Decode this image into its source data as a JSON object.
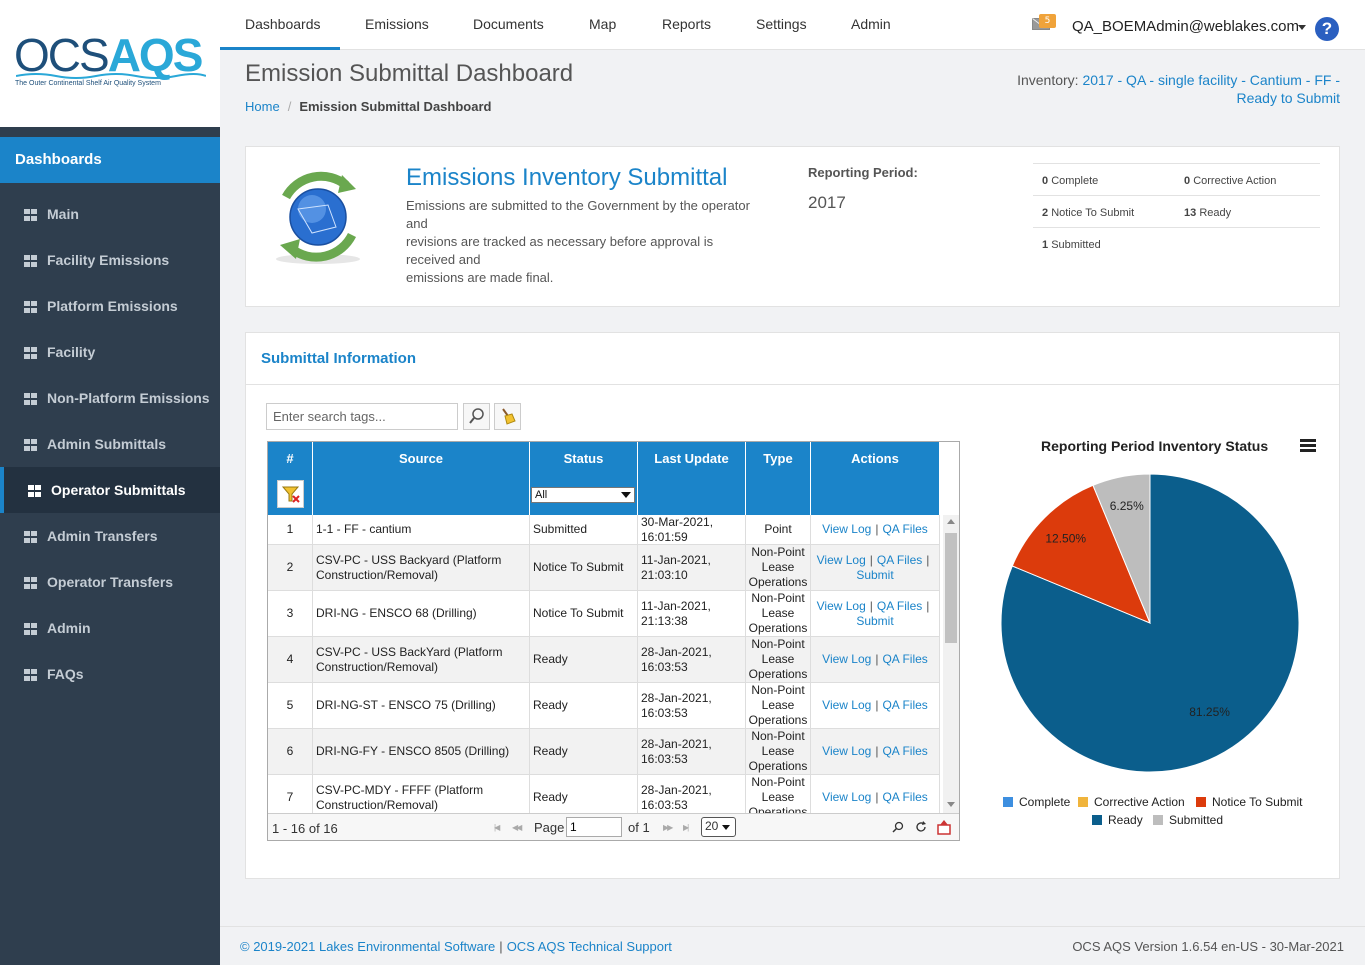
{
  "app": {
    "logo_ocs": "OCS",
    "logo_aqs": "AQS",
    "logo_tagline": "The Outer Continental Shelf Air Quality System"
  },
  "sidebar": {
    "section_title": "Dashboards",
    "items": [
      {
        "label": "Main",
        "active": false
      },
      {
        "label": "Facility Emissions",
        "active": false
      },
      {
        "label": "Platform Emissions",
        "active": false
      },
      {
        "label": "Facility",
        "active": false
      },
      {
        "label": "Non-Platform Emissions",
        "active": false
      },
      {
        "label": "Admin Submittals",
        "active": false
      },
      {
        "label": "Operator Submittals",
        "active": true
      },
      {
        "label": "Admin Transfers",
        "active": false
      },
      {
        "label": "Operator Transfers",
        "active": false
      },
      {
        "label": "Admin",
        "active": false
      },
      {
        "label": "FAQs",
        "active": false
      }
    ]
  },
  "topnav": {
    "items": [
      "Dashboards",
      "Emissions",
      "Documents",
      "Map",
      "Reports",
      "Settings",
      "Admin"
    ],
    "active": "Dashboards",
    "mail_count": "5",
    "user": "QA_BOEMAdmin@weblakes.com",
    "help": "?"
  },
  "page": {
    "title": "Emission Submittal Dashboard",
    "breadcrumb_home": "Home",
    "breadcrumb_sep": "/",
    "breadcrumb_current": "Emission Submittal Dashboard",
    "inventory_label": "Inventory:",
    "inventory_line1": "2017 - QA - single facility - Cantium - FF -",
    "inventory_line2": "Ready to Submit"
  },
  "summary": {
    "title": "Emissions Inventory Submittal",
    "desc_lines": [
      "Emissions are submitted to the Government by the operator",
      "and",
      "revisions are tracked as necessary before approval is",
      "received and",
      "emissions are made final."
    ],
    "period_label": "Reporting Period:",
    "period_value": "2017",
    "counts": {
      "complete": {
        "n": "0",
        "label": "Complete"
      },
      "corrective": {
        "n": "0",
        "label": "Corrective Action"
      },
      "notice": {
        "n": "2",
        "label": "Notice To Submit"
      },
      "ready": {
        "n": "13",
        "label": "Ready"
      },
      "submitted": {
        "n": "1",
        "label": "Submitted"
      }
    }
  },
  "submittal": {
    "panel_title": "Submittal Information",
    "search_placeholder": "Enter search tags...",
    "columns": [
      "#",
      "Source",
      "Status",
      "Last Update",
      "Type",
      "Actions"
    ],
    "status_filter": "All",
    "rows": [
      {
        "num": "1",
        "source": "1-1 - FF - cantium",
        "status": "Submitted",
        "update": "30-Mar-2021, 16:01:59",
        "type": "Point",
        "actions": [
          "View Log",
          "QA Files"
        ]
      },
      {
        "num": "2",
        "source": "CSV-PC - USS Backyard (Platform Construction/Removal)",
        "status": "Notice To Submit",
        "update": "11-Jan-2021, 21:03:10",
        "type": "Non-Point Lease Operations",
        "actions": [
          "View Log",
          "QA Files",
          "Submit"
        ]
      },
      {
        "num": "3",
        "source": "DRI-NG - ENSCO 68 (Drilling)",
        "status": "Notice To Submit",
        "update": "11-Jan-2021, 21:13:38",
        "type": "Non-Point Lease Operations",
        "actions": [
          "View Log",
          "QA Files",
          "Submit"
        ]
      },
      {
        "num": "4",
        "source": "CSV-PC - USS BackYard (Platform Construction/Removal)",
        "status": "Ready",
        "update": "28-Jan-2021, 16:03:53",
        "type": "Non-Point Lease Operations",
        "actions": [
          "View Log",
          "QA Files"
        ]
      },
      {
        "num": "5",
        "source": "DRI-NG-ST - ENSCO 75 (Drilling)",
        "status": "Ready",
        "update": "28-Jan-2021, 16:03:53",
        "type": "Non-Point Lease Operations",
        "actions": [
          "View Log",
          "QA Files"
        ]
      },
      {
        "num": "6",
        "source": "DRI-NG-FY - ENSCO 8505 (Drilling)",
        "status": "Ready",
        "update": "28-Jan-2021, 16:03:53",
        "type": "Non-Point Lease Operations",
        "actions": [
          "View Log",
          "QA Files"
        ]
      },
      {
        "num": "7",
        "source": "CSV-PC-MDY - FFFF (Platform Construction/Removal)",
        "status": "Ready",
        "update": "28-Jan-2021, 16:03:53",
        "type": "Non-Point Lease Operations",
        "actions": [
          "View Log",
          "QA Files"
        ]
      }
    ],
    "pager": {
      "range": "1 - 16 of 16",
      "page_label": "Page",
      "page_value": "1",
      "of_label": "of 1",
      "page_size": "20"
    }
  },
  "chart_data": {
    "type": "pie",
    "title": "Reporting Period Inventory Status",
    "categories": [
      "Complete",
      "Corrective Action",
      "Notice To Submit",
      "Ready",
      "Submitted"
    ],
    "values": [
      0,
      0,
      12.5,
      81.25,
      6.25
    ],
    "colors": [
      "#3d8fe0",
      "#f0b43c",
      "#dc3b0c",
      "#0b5e8c",
      "#bdbdbd"
    ],
    "legend_position": "bottom"
  },
  "footer": {
    "copyright": "© 2019-2021 Lakes Environmental Software",
    "sep": "|",
    "support": "OCS AQS Technical Support",
    "version": "OCS AQS Version 1.6.54 en-US - 30-Mar-2021"
  }
}
